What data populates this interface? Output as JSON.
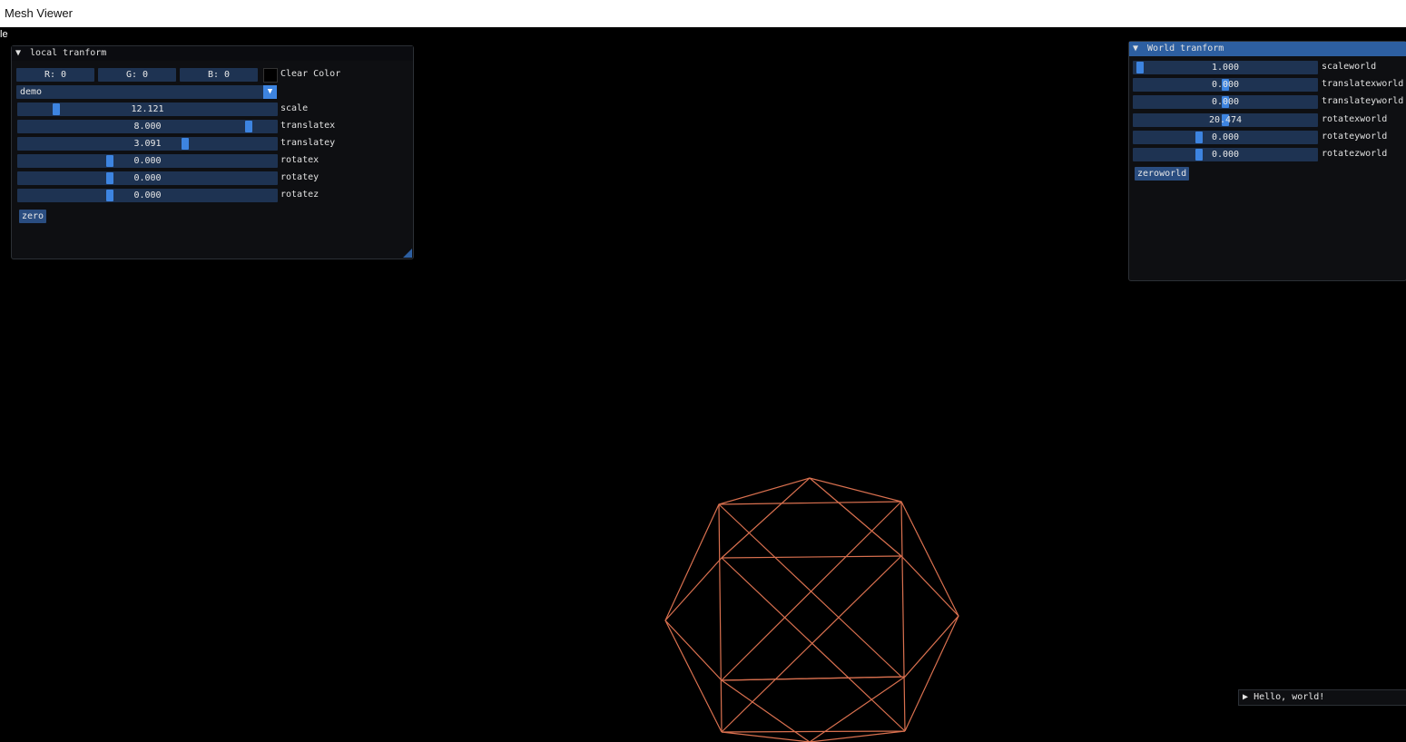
{
  "window": {
    "title": "Mesh Viewer",
    "menu": "le"
  },
  "local": {
    "header": "local tranform",
    "color": {
      "r": "R:  0",
      "g": "G:  0",
      "b": "B:  0",
      "label": "Clear Color"
    },
    "combo": "demo",
    "sliders": [
      {
        "value": "12.121",
        "label": "scale",
        "fraction": 0.14
      },
      {
        "value": "8.000",
        "label": "translatex",
        "fraction": 0.9
      },
      {
        "value": "3.091",
        "label": "translatey",
        "fraction": 0.65
      },
      {
        "value": "0.000",
        "label": "rotatex",
        "fraction": 0.35
      },
      {
        "value": "0.000",
        "label": "rotatey",
        "fraction": 0.35
      },
      {
        "value": "0.000",
        "label": "rotatez",
        "fraction": 0.35
      }
    ],
    "button": "zero"
  },
  "world": {
    "header": "World tranform",
    "sliders": [
      {
        "value": "1.000",
        "label": "scaleworld",
        "fraction": 0.02
      },
      {
        "value": "0.000",
        "label": "translatexworld",
        "fraction": 0.5
      },
      {
        "value": "0.000",
        "label": "translateyworld",
        "fraction": 0.5
      },
      {
        "value": "20.474",
        "label": "rotatexworld",
        "fraction": 0.5
      },
      {
        "value": "0.000",
        "label": "rotateyworld",
        "fraction": 0.35
      },
      {
        "value": "0.000",
        "label": "rotatezworld",
        "fraction": 0.35
      }
    ],
    "button": "zeroworld"
  },
  "hello": {
    "label": "Hello, world!"
  },
  "mesh": {
    "color": "#d9704f",
    "shape": "cuboctahedron-wireframe"
  }
}
